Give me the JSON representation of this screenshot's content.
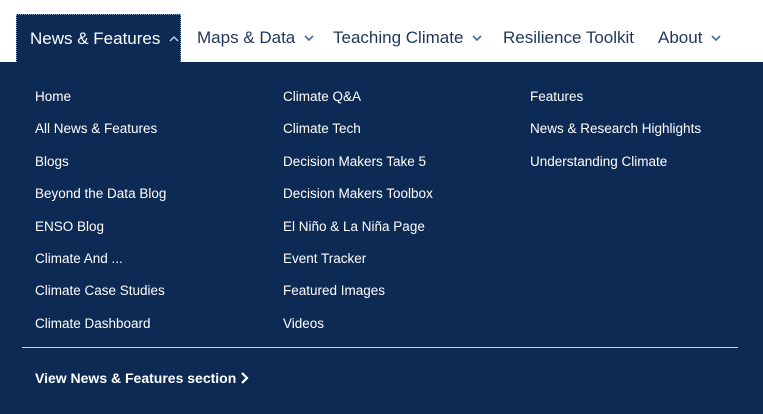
{
  "nav": {
    "items": [
      {
        "label": "News & Features",
        "state": "expanded"
      },
      {
        "label": "Maps & Data"
      },
      {
        "label": "Teaching Climate"
      },
      {
        "label": "Resilience Toolkit"
      },
      {
        "label": "About"
      }
    ],
    "chevron_icon": "chevron-down-icon",
    "active_chevron_icon": "chevron-up-icon"
  },
  "menu": {
    "columns": [
      {
        "links": [
          "Home",
          "All News & Features",
          "Blogs",
          "Beyond the Data Blog",
          "ENSO Blog",
          "Climate And ...",
          "Climate Case Studies",
          "Climate Dashboard"
        ]
      },
      {
        "links": [
          "Climate Q&A",
          "Climate Tech",
          "Decision Makers Take 5",
          "Decision Makers Toolbox",
          "El Niño & La Niña Page",
          "Event Tracker",
          "Featured Images",
          "Videos"
        ]
      },
      {
        "links": [
          "Features",
          "News & Research Highlights",
          "Understanding Climate"
        ]
      }
    ],
    "section_link": "View News & Features section",
    "section_link_icon": "chevron-right-icon"
  },
  "colors": {
    "panel_bg": "#0d2a55",
    "nav_text": "#1f3658",
    "link_text": "#ffffff"
  }
}
